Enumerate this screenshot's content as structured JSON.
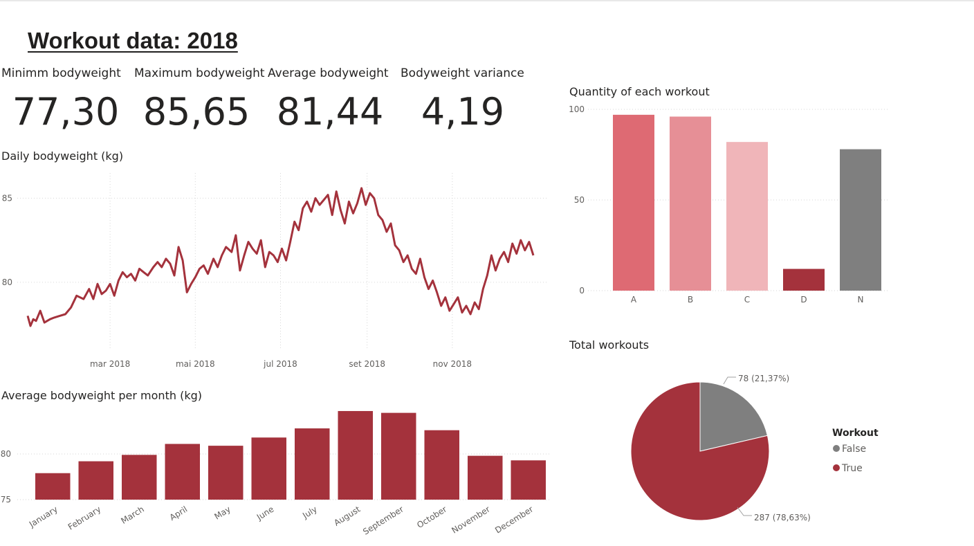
{
  "page": {
    "title": "Workout data: 2018"
  },
  "kpis": [
    {
      "label": "Minimm bodyweight",
      "value": "77,30"
    },
    {
      "label": "Maximum bodyweight",
      "value": "85,65"
    },
    {
      "label": "Average bodyweight",
      "value": "81,44"
    },
    {
      "label": "Bodyweight variance",
      "value": "4,19"
    }
  ],
  "colors": {
    "accent": "#a4323c",
    "grey": "#7f7f7f",
    "light1": "#de6a73",
    "light2": "#e68f96",
    "light3": "#f0b5b9"
  },
  "chart_data": [
    {
      "id": "daily",
      "type": "line",
      "title": "Daily bodyweight (kg)",
      "x_ticks": [
        "mar 2018",
        "mai 2018",
        "jul 2018",
        "set 2018",
        "nov 2018"
      ],
      "y_ticks": [
        80,
        85
      ],
      "ylim": [
        76.0,
        86.5
      ],
      "grid": true,
      "series": [
        {
          "x": [
            "2018-01-01",
            "2018-01-03",
            "2018-01-05",
            "2018-01-07",
            "2018-01-10",
            "2018-01-13",
            "2018-01-17",
            "2018-01-20",
            "2018-01-24",
            "2018-01-28",
            "2018-02-01",
            "2018-02-05",
            "2018-02-10",
            "2018-02-14",
            "2018-02-17",
            "2018-02-20",
            "2018-02-23",
            "2018-02-26",
            "2018-03-01",
            "2018-03-04",
            "2018-03-07",
            "2018-03-10",
            "2018-03-13",
            "2018-03-16",
            "2018-03-19",
            "2018-03-22",
            "2018-03-25",
            "2018-03-28",
            "2018-04-01",
            "2018-04-04",
            "2018-04-07",
            "2018-04-10",
            "2018-04-13",
            "2018-04-16",
            "2018-04-19",
            "2018-04-22",
            "2018-04-25",
            "2018-04-28",
            "2018-05-01",
            "2018-05-04",
            "2018-05-07",
            "2018-05-10",
            "2018-05-14",
            "2018-05-17",
            "2018-05-20",
            "2018-05-23",
            "2018-05-27",
            "2018-05-30",
            "2018-06-02",
            "2018-06-05",
            "2018-06-08",
            "2018-06-11",
            "2018-06-14",
            "2018-06-17",
            "2018-06-20",
            "2018-06-23",
            "2018-06-26",
            "2018-06-29",
            "2018-07-02",
            "2018-07-05",
            "2018-07-08",
            "2018-07-11",
            "2018-07-14",
            "2018-07-17",
            "2018-07-20",
            "2018-07-23",
            "2018-07-26",
            "2018-07-29",
            "2018-08-01",
            "2018-08-04",
            "2018-08-07",
            "2018-08-10",
            "2018-08-13",
            "2018-08-16",
            "2018-08-19",
            "2018-08-22",
            "2018-08-25",
            "2018-08-28",
            "2018-08-31",
            "2018-09-03",
            "2018-09-06",
            "2018-09-09",
            "2018-09-12",
            "2018-09-15",
            "2018-09-18",
            "2018-09-21",
            "2018-09-24",
            "2018-09-27",
            "2018-09-30",
            "2018-10-03",
            "2018-10-06",
            "2018-10-09",
            "2018-10-12",
            "2018-10-15",
            "2018-10-18",
            "2018-10-21",
            "2018-10-24",
            "2018-10-27",
            "2018-10-30",
            "2018-11-02",
            "2018-11-05",
            "2018-11-08",
            "2018-11-11",
            "2018-11-14",
            "2018-11-17",
            "2018-11-20",
            "2018-11-23",
            "2018-11-26",
            "2018-11-29",
            "2018-12-02",
            "2018-12-05",
            "2018-12-08",
            "2018-12-11",
            "2018-12-14",
            "2018-12-17",
            "2018-12-20",
            "2018-12-23",
            "2018-12-26",
            "2018-12-29"
          ],
          "y": [
            78.0,
            77.4,
            77.8,
            77.7,
            78.3,
            77.6,
            77.8,
            77.9,
            78.0,
            78.1,
            78.5,
            79.2,
            79.0,
            79.6,
            79.0,
            79.9,
            79.3,
            79.5,
            79.9,
            79.2,
            80.1,
            80.6,
            80.3,
            80.5,
            80.1,
            80.8,
            80.6,
            80.4,
            80.9,
            81.2,
            80.9,
            81.4,
            81.1,
            80.4,
            82.1,
            81.3,
            79.4,
            79.9,
            80.3,
            80.8,
            81.0,
            80.5,
            81.4,
            80.9,
            81.6,
            82.1,
            81.8,
            82.8,
            80.7,
            81.6,
            82.4,
            82.0,
            81.7,
            82.5,
            80.9,
            81.8,
            81.6,
            81.2,
            82.0,
            81.3,
            82.4,
            83.6,
            83.1,
            84.4,
            84.8,
            84.2,
            85.0,
            84.6,
            84.9,
            85.2,
            84.0,
            85.4,
            84.3,
            83.5,
            84.8,
            84.1,
            84.7,
            85.6,
            84.6,
            85.3,
            85.0,
            84.0,
            83.7,
            83.0,
            83.5,
            82.2,
            81.9,
            81.2,
            81.6,
            80.8,
            80.5,
            81.4,
            80.3,
            79.6,
            80.1,
            79.4,
            78.6,
            79.1,
            78.3,
            78.7,
            79.1,
            78.2,
            78.6,
            78.1,
            78.8,
            78.4,
            79.6,
            80.4,
            81.6,
            80.7,
            81.4,
            81.8,
            81.2,
            82.3,
            81.7,
            82.5,
            81.9,
            82.4,
            81.6
          ]
        }
      ]
    },
    {
      "id": "monthly",
      "type": "bar",
      "title": "Average bodyweight per month (kg)",
      "categories": [
        "January",
        "February",
        "March",
        "April",
        "May",
        "June",
        "July",
        "August",
        "September",
        "October",
        "November",
        "December"
      ],
      "values": [
        77.9,
        79.2,
        79.9,
        81.1,
        80.9,
        81.8,
        82.8,
        84.7,
        84.5,
        82.6,
        79.8,
        79.3
      ],
      "y_ticks": [
        75,
        80
      ],
      "ylim": [
        75,
        85
      ],
      "grid": true
    },
    {
      "id": "quantity",
      "type": "bar",
      "title": "Quantity of each workout",
      "categories": [
        "A",
        "B",
        "C",
        "D",
        "N"
      ],
      "values": [
        97,
        96,
        82,
        12,
        78
      ],
      "y_ticks": [
        0,
        50,
        100
      ],
      "ylim": [
        0,
        100
      ],
      "grid": true
    },
    {
      "id": "total",
      "type": "pie",
      "title": "Total workouts",
      "legend_title": "Workout",
      "legend_position": "right",
      "slices": [
        {
          "label": "False",
          "value": 78,
          "data_label": "78 (21,37%)"
        },
        {
          "label": "True",
          "value": 287,
          "data_label": "287 (78,63%)"
        }
      ]
    }
  ]
}
